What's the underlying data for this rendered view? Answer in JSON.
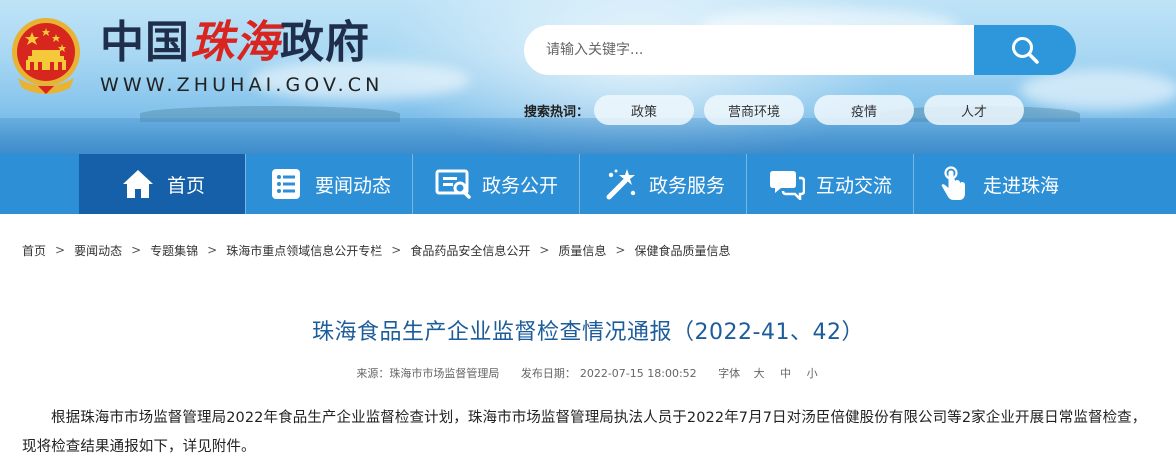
{
  "header": {
    "logo": {
      "part1": "中国",
      "part2": "珠海",
      "part3": "政府",
      "url": "WWW.ZHUHAI.GOV.CN"
    },
    "search": {
      "placeholder": "请输入关键字...",
      "icon": "search-icon"
    },
    "hot": {
      "label": "搜索热词：",
      "tags": [
        "政策",
        "营商环境",
        "疫情",
        "人才"
      ]
    }
  },
  "nav": {
    "items": [
      {
        "label": "首页",
        "icon": "home-icon"
      },
      {
        "label": "要闻动态",
        "icon": "news-list-icon"
      },
      {
        "label": "政务公开",
        "icon": "open-affairs-icon"
      },
      {
        "label": "政务服务",
        "icon": "service-wand-icon"
      },
      {
        "label": "互动交流",
        "icon": "chat-icon"
      },
      {
        "label": "走进珠海",
        "icon": "hand-pointer-icon"
      }
    ],
    "active_index": 0,
    "colors": {
      "bar": "#2d8fd6",
      "active": "#1560a8"
    }
  },
  "breadcrumb": [
    "首页",
    "要闻动态",
    "专题集锦",
    "珠海市重点领域信息公开专栏",
    "食品药品安全信息公开",
    "质量信息",
    "保健食品质量信息"
  ],
  "breadcrumb_separator": ">",
  "article": {
    "title": "珠海食品生产企业监督检查情况通报（2022-41、42）",
    "source_label": "来源：珠海市市场监督管理局",
    "date_label": "发布日期：",
    "date": "2022-07-15 18:00:52",
    "font_size_label": "字体",
    "font_large": "大",
    "font_medium": "中",
    "font_small": "小",
    "body": "根据珠海市市场监督管理局2022年食品生产企业监督检查计划，珠海市市场监督管理局执法人员于2022年7月7日对汤臣倍健股份有限公司等2家企业开展日常监督检查，现将检查结果通报如下，详见附件。"
  },
  "colors": {
    "title": "#1d5c9b",
    "brand_red": "#d8251f",
    "search_button": "#2e97dc"
  }
}
